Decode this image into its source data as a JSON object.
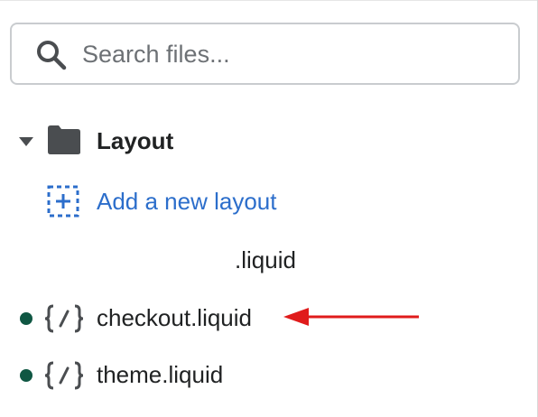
{
  "search": {
    "icon": "search-icon",
    "placeholder": "Search files...",
    "value": ""
  },
  "tree": {
    "folder": {
      "label": "Layout",
      "expanded": true,
      "icon": "folder-icon",
      "caret_icon": "caret-down-icon"
    },
    "add_link": {
      "label": "Add a new layout",
      "icon": "add-file-icon"
    },
    "files": [
      {
        "label": ".liquid",
        "icon": "none",
        "modified": false
      },
      {
        "label": "checkout.liquid",
        "icon": "code-icon",
        "modified": true
      },
      {
        "label": "theme.liquid",
        "icon": "code-icon",
        "modified": true
      }
    ]
  },
  "annotation": {
    "type": "arrow",
    "color": "#e01b1b",
    "points_to": "checkout.liquid"
  },
  "colors": {
    "link": "#2c6ecb",
    "modified_dot": "#0f5743",
    "icon": "#4a4d50",
    "text": "#202223"
  }
}
